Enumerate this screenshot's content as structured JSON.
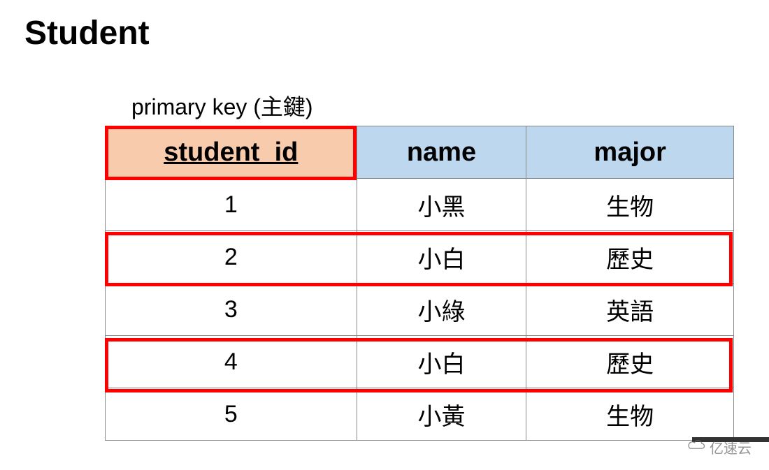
{
  "title": "Student",
  "pk_label": "primary key (主鍵)",
  "columns": {
    "id": "student_id",
    "name": "name",
    "major": "major"
  },
  "rows": [
    {
      "id": "1",
      "name": "小黑",
      "major": "生物"
    },
    {
      "id": "2",
      "name": "小白",
      "major": "歷史"
    },
    {
      "id": "3",
      "name": "小綠",
      "major": "英語"
    },
    {
      "id": "4",
      "name": "小白",
      "major": "歷史"
    },
    {
      "id": "5",
      "name": "小黃",
      "major": "生物"
    }
  ],
  "watermark": "亿速云",
  "chart_data": {
    "type": "table",
    "title": "Student",
    "primary_key": "student_id",
    "columns": [
      "student_id",
      "name",
      "major"
    ],
    "data": [
      [
        1,
        "小黑",
        "生物"
      ],
      [
        2,
        "小白",
        "歷史"
      ],
      [
        3,
        "小綠",
        "英語"
      ],
      [
        4,
        "小白",
        "歷史"
      ],
      [
        5,
        "小黃",
        "生物"
      ]
    ],
    "highlighted_rows": [
      2,
      4
    ],
    "highlighted_columns": [
      "student_id"
    ]
  }
}
